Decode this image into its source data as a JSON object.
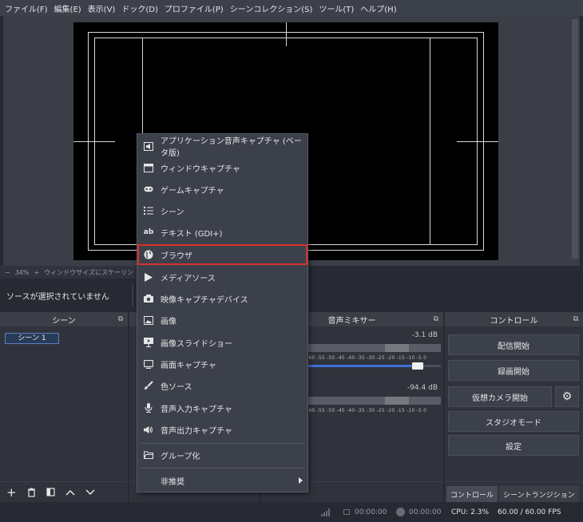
{
  "menubar": {
    "items": [
      "ファイル(F)",
      "編集(E)",
      "表示(V)",
      "ドック(D)",
      "プロファイル(P)",
      "シーンコレクション(S)",
      "ツール(T)",
      "ヘルプ(H)"
    ]
  },
  "zoom": {
    "minus": "−",
    "value": "34%",
    "plus": "+",
    "fit": "ウィンドウサイズにスケーリン"
  },
  "source_status": "ソースが選択されていません",
  "docks": {
    "scenes": {
      "title": "シーン",
      "items": [
        "シーン 1"
      ]
    },
    "mixer": {
      "title": "音声ミキサー",
      "channels": [
        {
          "db": "-3.1 dB",
          "scale": "-60 -55 -50 -45 -40 -35 -30 -25 -20 -15 -10 -5 0",
          "volume_pct": 83
        },
        {
          "db": "-94.4 dB",
          "scale": "-60 -55 -50 -45 -40 -35 -30 -25 -20 -15 -10 -5 0",
          "volume_pct": 0
        }
      ]
    },
    "controls": {
      "title": "コントロール",
      "buttons": {
        "stream": "配信開始",
        "record": "録画開始",
        "virtualcam": "仮想カメラ開始",
        "studio": "スタジオモード",
        "settings": "設定"
      },
      "tabs": [
        "コントロール",
        "シーントランジション"
      ]
    }
  },
  "context_menu": {
    "items": [
      {
        "label": "アプリケーション音声キャプチャ (ベータ版)",
        "icon": "app-audio-icon"
      },
      {
        "label": "ウィンドウキャプチャ",
        "icon": "window-icon"
      },
      {
        "label": "ゲームキャプチャ",
        "icon": "gamepad-icon"
      },
      {
        "label": "シーン",
        "icon": "list-icon"
      },
      {
        "label": "テキスト (GDI+)",
        "icon": "text-icon"
      },
      {
        "label": "ブラウザ",
        "icon": "globe-icon"
      },
      {
        "label": "メディアソース",
        "icon": "play-icon"
      },
      {
        "label": "映像キャプチャデバイス",
        "icon": "camera-icon"
      },
      {
        "label": "画像",
        "icon": "image-icon"
      },
      {
        "label": "画像スライドショー",
        "icon": "slideshow-icon"
      },
      {
        "label": "画面キャプチャ",
        "icon": "monitor-icon"
      },
      {
        "label": "色ソース",
        "icon": "brush-icon"
      },
      {
        "label": "音声入力キャプチャ",
        "icon": "microphone-icon"
      },
      {
        "label": "音声出力キャプチャ",
        "icon": "speaker-icon"
      }
    ],
    "group": {
      "label": "グループ化",
      "icon": "folder-icon"
    },
    "deprecated": {
      "label": "非推奨"
    },
    "highlight_color": "#d9302b"
  },
  "statusbar": {
    "stream_time": "00:00:00",
    "record_time": "00:00:00",
    "cpu": "CPU: 2.3%",
    "fps": "60.00 / 60.00 FPS"
  }
}
